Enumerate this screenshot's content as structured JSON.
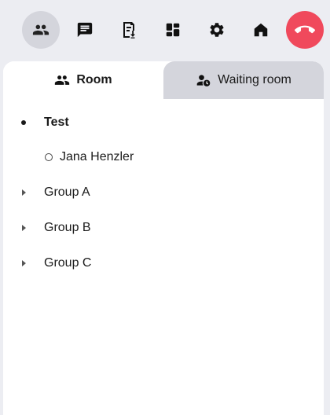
{
  "toolbar": {
    "buttons": [
      {
        "icon": "participants-icon",
        "active": true
      },
      {
        "icon": "chat-icon",
        "active": false
      },
      {
        "icon": "file-download-icon",
        "active": false
      },
      {
        "icon": "dashboard-icon",
        "active": false
      },
      {
        "icon": "gear-icon",
        "active": false
      },
      {
        "icon": "home-icon",
        "active": false
      },
      {
        "icon": "hang-up-icon",
        "active": false
      }
    ],
    "colors": {
      "active_bg": "#d4d5dc",
      "hangup_bg": "#f0495c"
    }
  },
  "tabs": {
    "room_label": "Room",
    "waiting_label": "Waiting room",
    "selected": "Room"
  },
  "tree": {
    "room": {
      "label": "Test",
      "expanded": true
    },
    "participant": {
      "label": "Jana Henzler",
      "status": "offline"
    },
    "groups": [
      {
        "label": "Group A",
        "expanded": false
      },
      {
        "label": "Group B",
        "expanded": false
      },
      {
        "label": "Group C",
        "expanded": false
      }
    ]
  }
}
